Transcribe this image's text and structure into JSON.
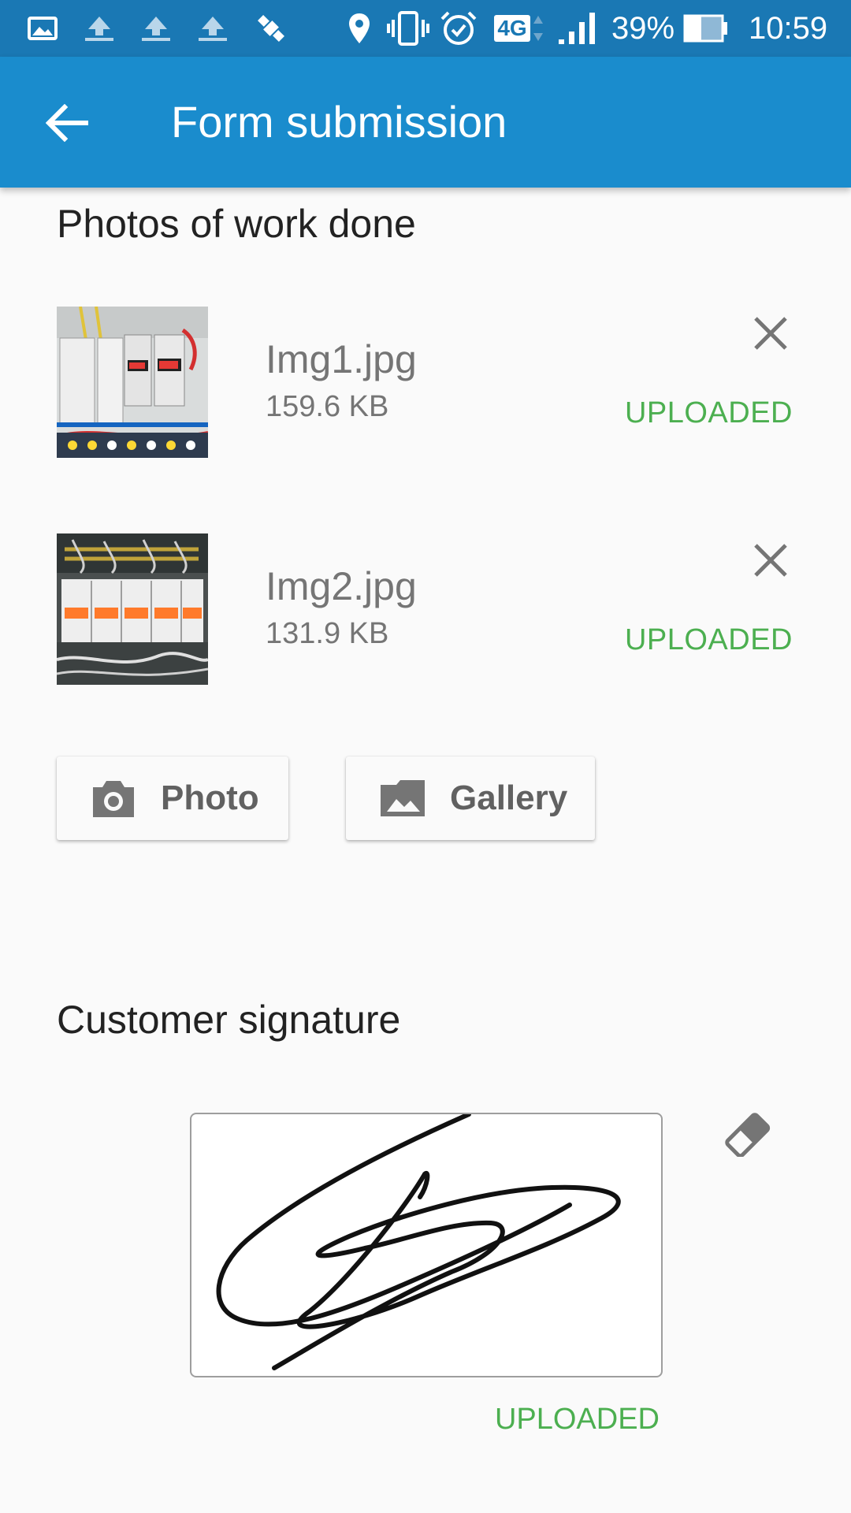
{
  "status_bar": {
    "network_label": "4G",
    "battery_percent": "39%",
    "time": "10:59",
    "icons": [
      "gallery-icon",
      "upload-icon",
      "upload-icon",
      "upload-icon",
      "satellite-icon",
      "location-icon",
      "vibrate-icon",
      "alarm-icon",
      "network-4g-icon",
      "signal-icon",
      "battery-icon"
    ]
  },
  "app_bar": {
    "title": "Form submission",
    "back_icon": "arrow-back-icon"
  },
  "photos": {
    "section_title": "Photos of work done",
    "files": [
      {
        "name": "Img1.jpg",
        "size": "159.6 KB",
        "status": "UPLOADED"
      },
      {
        "name": "Img2.jpg",
        "size": "131.9 KB",
        "status": "UPLOADED"
      }
    ],
    "photo_button": {
      "label": "Photo",
      "icon": "camera-icon"
    },
    "gallery_button": {
      "label": "Gallery",
      "icon": "image-icon"
    }
  },
  "signature": {
    "section_title": "Customer signature",
    "status": "UPLOADED",
    "clear_icon": "eraser-icon"
  },
  "colors": {
    "status_bar": "#1a78b4",
    "app_bar": "#1a8ccd",
    "uploaded_green": "#4caf50",
    "background": "#fafafa"
  }
}
